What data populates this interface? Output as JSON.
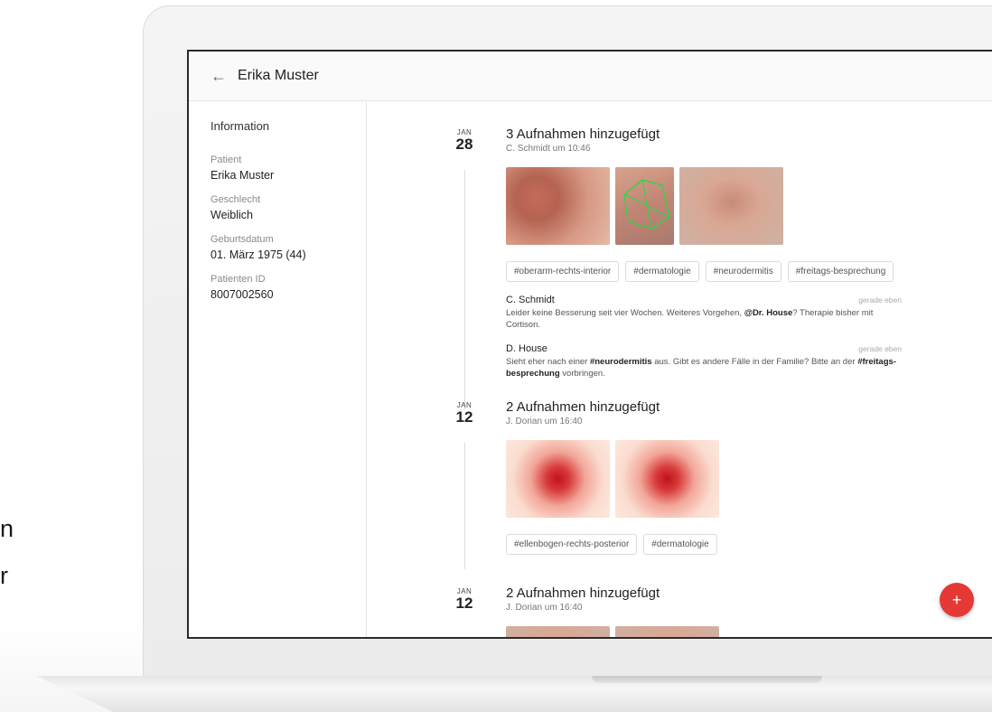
{
  "side_text": [
    "n",
    "r"
  ],
  "header": {
    "back_icon": "arrow-left-icon",
    "title": "Erika Muster"
  },
  "sidebar": {
    "heading": "Information",
    "fields": [
      {
        "label": "Patient",
        "value": "Erika Muster"
      },
      {
        "label": "Geschlecht",
        "value": "Weiblich"
      },
      {
        "label": "Geburtsdatum",
        "value": "01. März 1975 (44)"
      },
      {
        "label": "Patienten ID",
        "value": "8007002560"
      }
    ]
  },
  "timeline": [
    {
      "month": "JAN",
      "day": "28",
      "title": "3 Aufnahmen hinzugefügt",
      "subtitle": "C. Schmidt um 10:46",
      "tags": [
        "#oberarm-rechts-interior",
        "#dermatologie",
        "#neurodermitis",
        "#freitags-besprechung"
      ],
      "comments": [
        {
          "author": "C. Schmidt",
          "time": "gerade eben",
          "text_before": "Leider keine Besserung seit vier Wochen. Weiteres Vorgehen, ",
          "mention": "@Dr. House",
          "text_after": "? Therapie bisher mit Cortison."
        },
        {
          "author": "D. House",
          "time": "gerade eben",
          "text_before": "Sieht eher nach einer ",
          "tag1": "#neurodermitis",
          "text_mid": " aus. Gibt es andere Fälle in der Familie? Bitte an der ",
          "tag2": "#freitags-besprechung",
          "text_after": " vorbringen."
        }
      ]
    },
    {
      "month": "JAN",
      "day": "12",
      "title": "2 Aufnahmen hinzugefügt",
      "subtitle": "J. Dorian um 16:40",
      "tags": [
        "#ellenbogen-rechts-posterior",
        "#dermatologie"
      ]
    },
    {
      "month": "JAN",
      "day": "12",
      "title": "2 Aufnahmen hinzugefügt",
      "subtitle": "J. Dorian um 16:40"
    }
  ],
  "fab": {
    "label": "+",
    "icon": "plus-icon",
    "color": "#e53935"
  }
}
